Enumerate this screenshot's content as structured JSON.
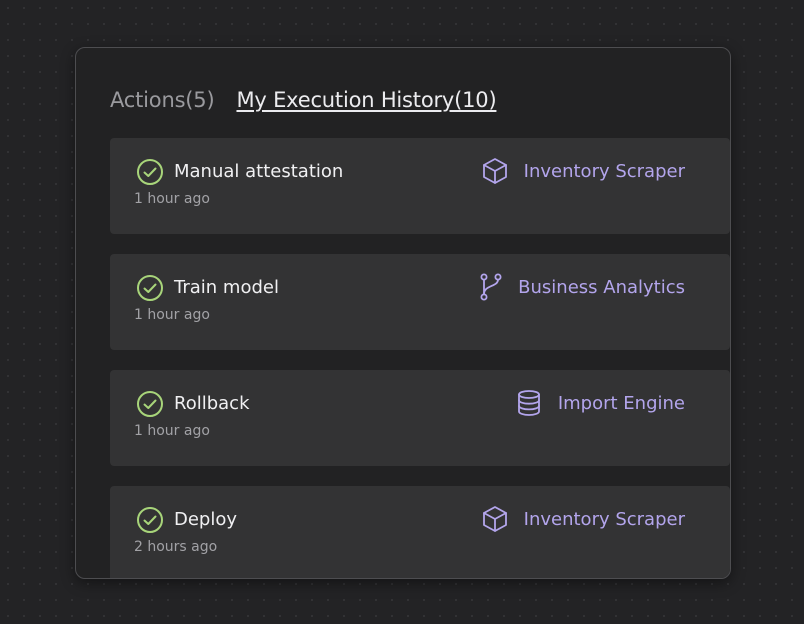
{
  "tabs": [
    {
      "label": "Actions(5)",
      "active": false
    },
    {
      "label": "My Execution History(10)",
      "active": true
    }
  ],
  "executions": [
    {
      "title": "Manual attestation",
      "time": "1 hour ago",
      "project": "Inventory Scraper",
      "project_icon": "cube-icon"
    },
    {
      "title": "Train model",
      "time": "1 hour ago",
      "project": "Business Analytics",
      "project_icon": "git-branch-icon"
    },
    {
      "title": "Rollback",
      "time": "1 hour ago",
      "project": "Import Engine",
      "project_icon": "database-icon"
    },
    {
      "title": "Deploy",
      "time": "2 hours ago",
      "project": "Inventory Scraper",
      "project_icon": "cube-icon"
    }
  ],
  "colors": {
    "success": "#a8d57a",
    "accent": "#b3a5ec",
    "card": "#333334",
    "panel": "#222223"
  }
}
